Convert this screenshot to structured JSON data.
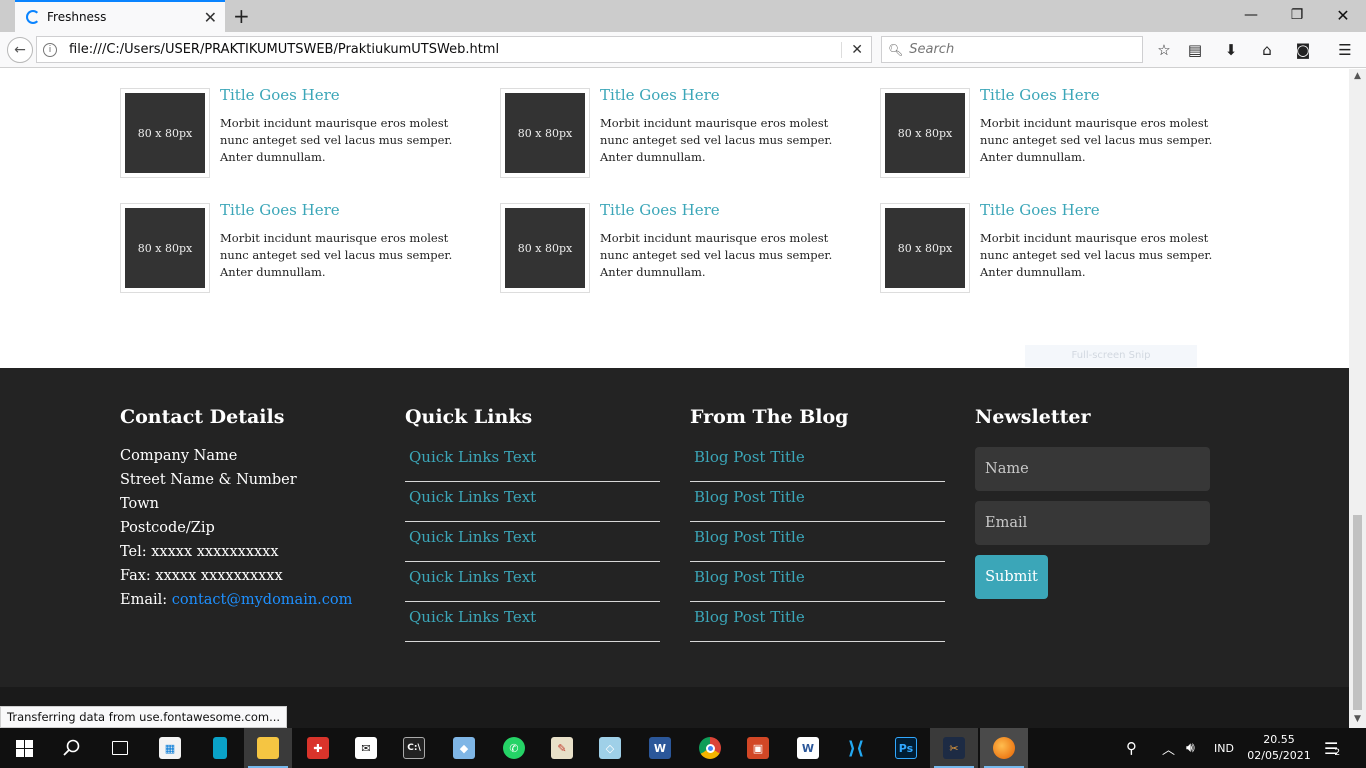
{
  "browser": {
    "tab_title": "Freshness",
    "url": "file:///C:/Users/USER/PRAKTIKUMUTSWEB/PraktiukumUTSWeb.html",
    "search_placeholder": "Search",
    "status_text": "Transferring data from use.fontawesome.com..."
  },
  "posts": [
    {
      "thumb": "80 x 80px",
      "title": "Title Goes Here",
      "text": "Morbit incidunt maurisque eros molest nunc anteget sed vel lacus mus semper. Anter dumnullam."
    },
    {
      "thumb": "80 x 80px",
      "title": "Title Goes Here",
      "text": "Morbit incidunt maurisque eros molest nunc anteget sed vel lacus mus semper. Anter dumnullam."
    },
    {
      "thumb": "80 x 80px",
      "title": "Title Goes Here",
      "text": "Morbit incidunt maurisque eros molest nunc anteget sed vel lacus mus semper. Anter dumnullam."
    },
    {
      "thumb": "80 x 80px",
      "title": "Title Goes Here",
      "text": "Morbit incidunt maurisque eros molest nunc anteget sed vel lacus mus semper. Anter dumnullam."
    },
    {
      "thumb": "80 x 80px",
      "title": "Title Goes Here",
      "text": "Morbit incidunt maurisque eros molest nunc anteget sed vel lacus mus semper. Anter dumnullam."
    },
    {
      "thumb": "80 x 80px",
      "title": "Title Goes Here",
      "text": "Morbit incidunt maurisque eros molest nunc anteget sed vel lacus mus semper. Anter dumnullam."
    }
  ],
  "overlay": {
    "snip_label": "Full-screen Snip"
  },
  "footer": {
    "contact": {
      "title": "Contact Details",
      "company": "Company Name",
      "street": "Street Name & Number",
      "town": "Town",
      "postcode": "Postcode/Zip",
      "tel": "Tel: xxxxx xxxxxxxxxx",
      "fax": "Fax: xxxxx xxxxxxxxxx",
      "email_label": "Email: ",
      "email": "contact@mydomain.com"
    },
    "quick_links": {
      "title": "Quick Links",
      "items": [
        "Quick Links Text",
        "Quick Links Text",
        "Quick Links Text",
        "Quick Links Text",
        "Quick Links Text"
      ]
    },
    "blog": {
      "title": "From The Blog",
      "items": [
        "Blog Post Title",
        "Blog Post Title",
        "Blog Post Title",
        "Blog Post Title",
        "Blog Post Title"
      ]
    },
    "newsletter": {
      "title": "Newsletter",
      "name_placeholder": "Name",
      "email_placeholder": "Email",
      "submit_label": "Submit"
    }
  },
  "taskbar": {
    "language": "IND",
    "time": "20.55",
    "date": "02/05/2021",
    "notification_count": "2"
  }
}
